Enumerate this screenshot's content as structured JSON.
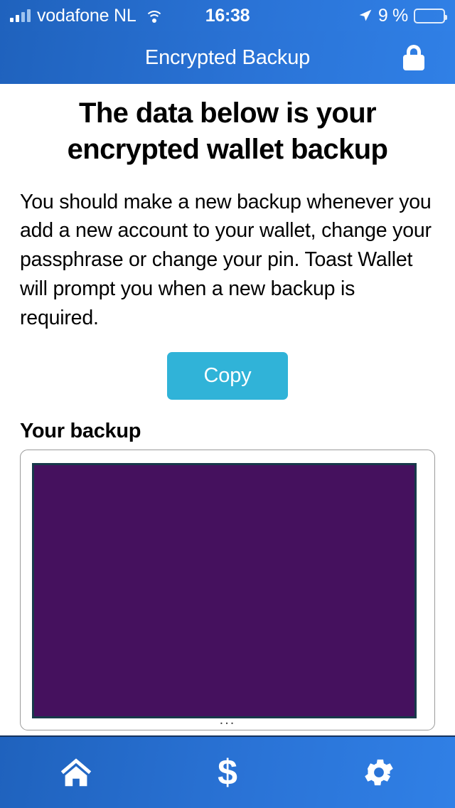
{
  "status_bar": {
    "carrier": "vodafone NL",
    "time": "16:38",
    "battery_percent": "9 %",
    "battery_level": 9,
    "signal_icon": "signal-bars-icon",
    "wifi_icon": "wifi-icon",
    "location_icon": "location-arrow-icon",
    "battery_icon": "battery-icon"
  },
  "navbar": {
    "title": "Encrypted Backup",
    "action_icon": "lock-icon"
  },
  "main": {
    "heading": "The data below is your encrypted wallet backup",
    "body": "You should make a new backup whenever you add a new account to your wallet, change your passphrase or change your pin. Toast Wallet will prompt you when a new backup is required.",
    "copy_button": "Copy",
    "backup_label": "Your backup",
    "backup_value": "",
    "backup_overflow_indicator": "...",
    "backup_redacted": true
  },
  "tabbar": {
    "items": [
      {
        "name": "home",
        "icon": "home-icon",
        "glyph": ""
      },
      {
        "name": "funds",
        "icon": "dollar-icon",
        "glyph": "$"
      },
      {
        "name": "settings",
        "icon": "gear-icon",
        "glyph": ""
      }
    ]
  },
  "colors": {
    "header_blue_dark": "#1f62bd",
    "header_blue_light": "#3080e6",
    "copy_button": "#30b3d8",
    "redaction_purple": "#45115e",
    "redaction_border": "#17394a",
    "battery_warning": "#ffc400"
  }
}
